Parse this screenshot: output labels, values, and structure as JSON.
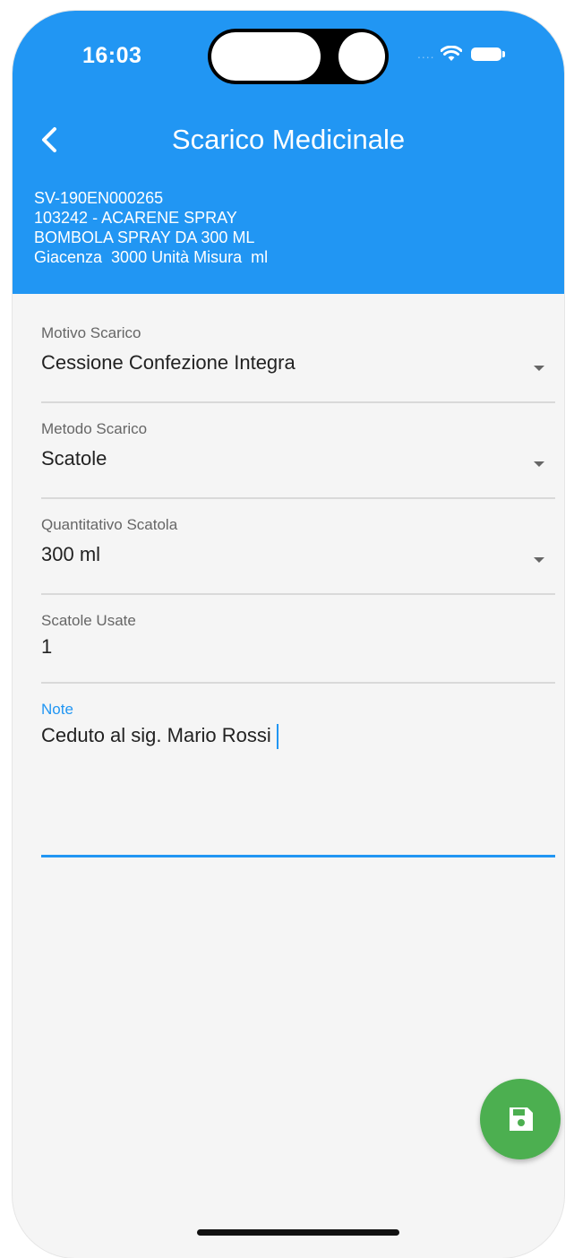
{
  "status_bar": {
    "time": "16:03",
    "signal": "....",
    "icons": [
      "wifi-icon",
      "battery-icon"
    ]
  },
  "app_bar": {
    "title": "Scarico Medicinale",
    "back_icon": "chevron-left-icon"
  },
  "product_info": {
    "code": "SV-190EN000265",
    "name": "103242 - ACARENE SPRAY",
    "package": "BOMBOLA SPRAY DA 300 ML",
    "stock": "Giacenza  3000 Unità Misura  ml"
  },
  "form": {
    "motivo": {
      "label": "Motivo Scarico",
      "value": "Cessione Confezione Integra"
    },
    "metodo": {
      "label": "Metodo Scarico",
      "value": "Scatole"
    },
    "quantitativo": {
      "label": "Quantitativo Scatola",
      "value": "300 ml"
    },
    "scatole": {
      "label": "Scatole Usate",
      "value": "1"
    },
    "note": {
      "label": "Note",
      "value": "Ceduto al sig. Mario Rossi"
    }
  },
  "fab": {
    "icon": "save-icon"
  },
  "colors": {
    "primary": "#2196f3",
    "fab": "#4caf50",
    "background": "#f5f5f5"
  }
}
